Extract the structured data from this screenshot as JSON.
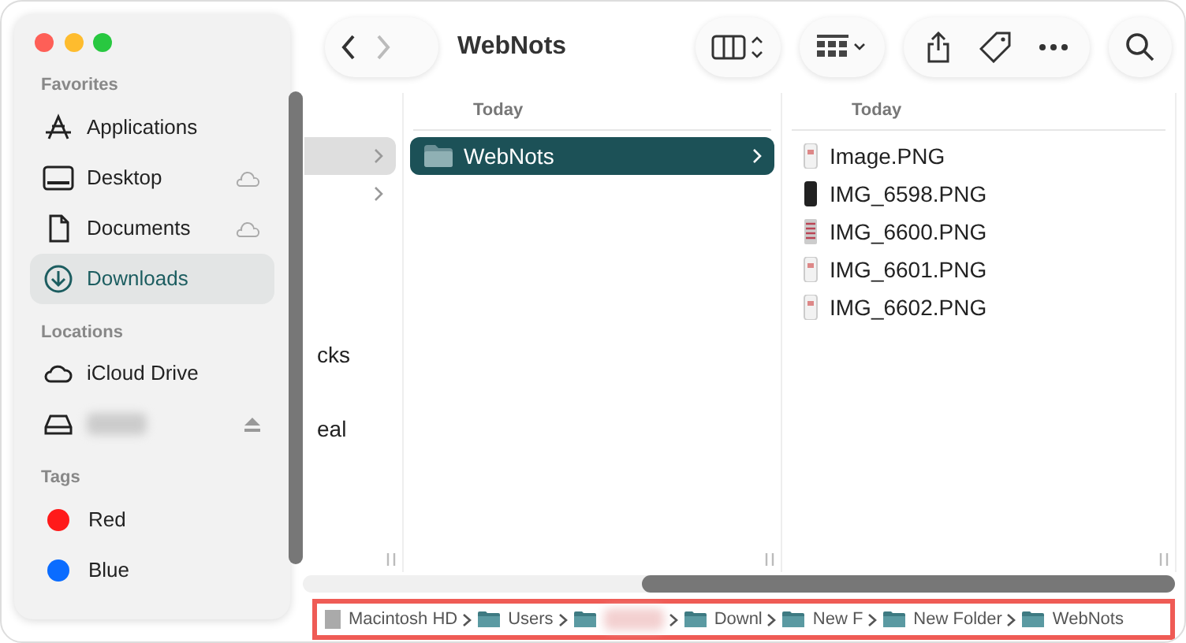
{
  "window": {
    "title": "WebNots"
  },
  "sidebar": {
    "sections": [
      {
        "heading": "Favorites",
        "items": [
          {
            "label": "Applications",
            "selected": false
          },
          {
            "label": "Desktop",
            "cloud": true,
            "selected": false
          },
          {
            "label": "Documents",
            "cloud": true,
            "selected": false
          },
          {
            "label": "Downloads",
            "selected": true
          }
        ]
      },
      {
        "heading": "Locations",
        "items": [
          {
            "label": "iCloud Drive",
            "selected": false
          },
          {
            "blurred": true,
            "eject": true,
            "selected": false
          }
        ]
      },
      {
        "heading": "Tags",
        "items": [
          {
            "label": "Red",
            "color": "#ff1a1a",
            "selected": false
          },
          {
            "label": "Blue",
            "color": "#0a6cff",
            "selected": false
          }
        ]
      }
    ]
  },
  "columns": [
    {
      "rows": [
        {
          "chevron": true,
          "selected": true
        },
        {
          "chevron": true,
          "selected": false
        },
        {
          "label": "cks",
          "selected": false
        },
        {
          "label": "eal",
          "selected": false
        }
      ]
    },
    {
      "header": "Today",
      "rows": [
        {
          "label": "WebNots",
          "chevron": true,
          "selected": true
        }
      ]
    },
    {
      "header": "Today",
      "rows": [
        {
          "label": "Image.PNG",
          "selected": false
        },
        {
          "label": "IMG_6598.PNG",
          "selected": false
        },
        {
          "label": "IMG_6600.PNG",
          "selected": false
        },
        {
          "label": "IMG_6601.PNG",
          "selected": false
        },
        {
          "label": "IMG_6602.PNG",
          "selected": false
        }
      ]
    }
  ],
  "path_bar": {
    "highlighted": true,
    "items": [
      {
        "label": "Macintosh HD"
      },
      {
        "label": "Users"
      },
      {
        "blurred": true
      },
      {
        "label": "Downl"
      },
      {
        "label": "New F"
      },
      {
        "label": "New Folder"
      },
      {
        "label": "WebNots"
      }
    ]
  }
}
